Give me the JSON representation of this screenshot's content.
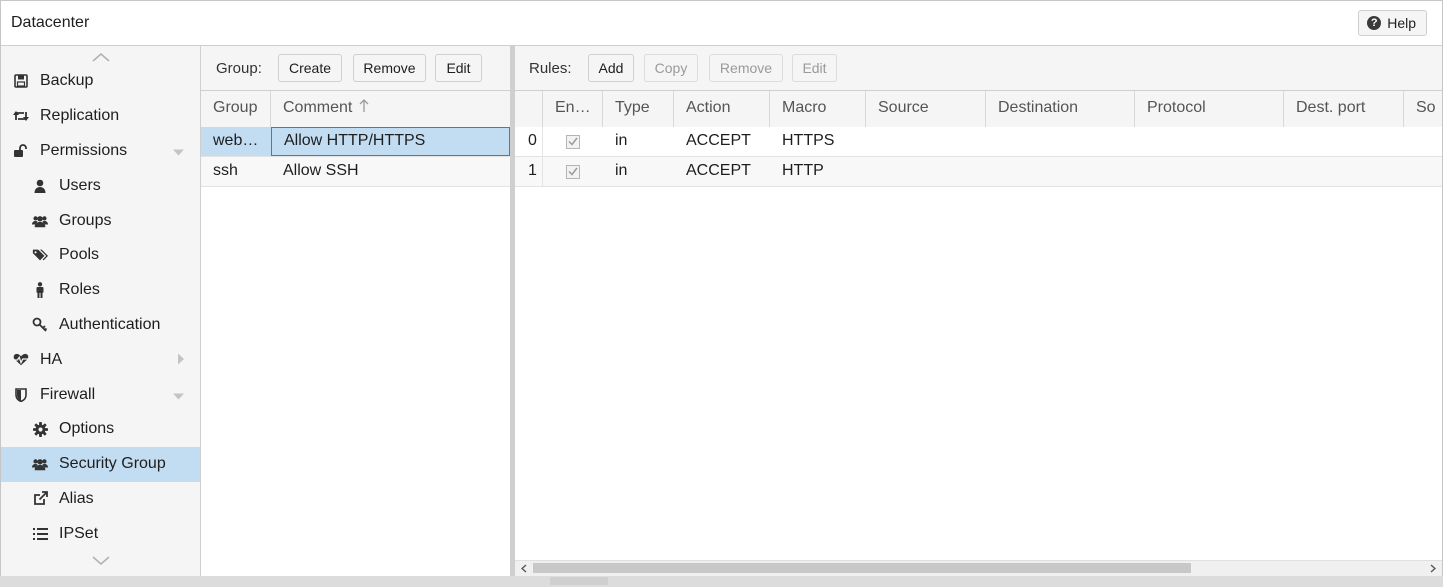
{
  "header": {
    "title": "Datacenter",
    "help_label": "Help"
  },
  "sidebar": {
    "items": [
      {
        "label": "Backup",
        "icon": "save-icon",
        "level": 0
      },
      {
        "label": "Replication",
        "icon": "retweet-icon",
        "level": 0
      },
      {
        "label": "Permissions",
        "icon": "unlock-icon",
        "level": 0,
        "caret": "down"
      },
      {
        "label": "Users",
        "icon": "user-icon",
        "level": 1
      },
      {
        "label": "Groups",
        "icon": "users-icon",
        "level": 1
      },
      {
        "label": "Pools",
        "icon": "tags-icon",
        "level": 1
      },
      {
        "label": "Roles",
        "icon": "male-icon",
        "level": 1
      },
      {
        "label": "Authentication",
        "icon": "key-icon",
        "level": 1
      },
      {
        "label": "HA",
        "icon": "heartbeat-icon",
        "level": 0,
        "caret": "right"
      },
      {
        "label": "Firewall",
        "icon": "shield-icon",
        "level": 0,
        "caret": "down"
      },
      {
        "label": "Options",
        "icon": "gear-icon",
        "level": 1
      },
      {
        "label": "Security Group",
        "icon": "users-icon",
        "level": 1,
        "selected": true
      },
      {
        "label": "Alias",
        "icon": "external-link-icon",
        "level": 1
      },
      {
        "label": "IPSet",
        "icon": "list-icon",
        "level": 1
      }
    ]
  },
  "groups": {
    "toolbar_label": "Group:",
    "buttons": {
      "create": "Create",
      "remove": "Remove",
      "edit": "Edit"
    },
    "columns": {
      "group": "Group",
      "comment": "Comment"
    },
    "rows": [
      {
        "group": "web…",
        "comment": "Allow HTTP/HTTPS",
        "selected": true
      },
      {
        "group": "ssh",
        "comment": "Allow SSH"
      }
    ]
  },
  "rules": {
    "toolbar_label": "Rules:",
    "buttons": {
      "add": "Add",
      "copy": "Copy",
      "remove": "Remove",
      "edit": "Edit"
    },
    "columns": {
      "enable": "En…",
      "type": "Type",
      "action": "Action",
      "macro": "Macro",
      "source": "Source",
      "destination": "Destination",
      "protocol": "Protocol",
      "dest_port": "Dest. port",
      "source_port": "So"
    },
    "rows": [
      {
        "pos": "0",
        "enabled": true,
        "type": "in",
        "action": "ACCEPT",
        "macro": "HTTPS"
      },
      {
        "pos": "1",
        "enabled": true,
        "type": "in",
        "action": "ACCEPT",
        "macro": "HTTP"
      }
    ]
  }
}
